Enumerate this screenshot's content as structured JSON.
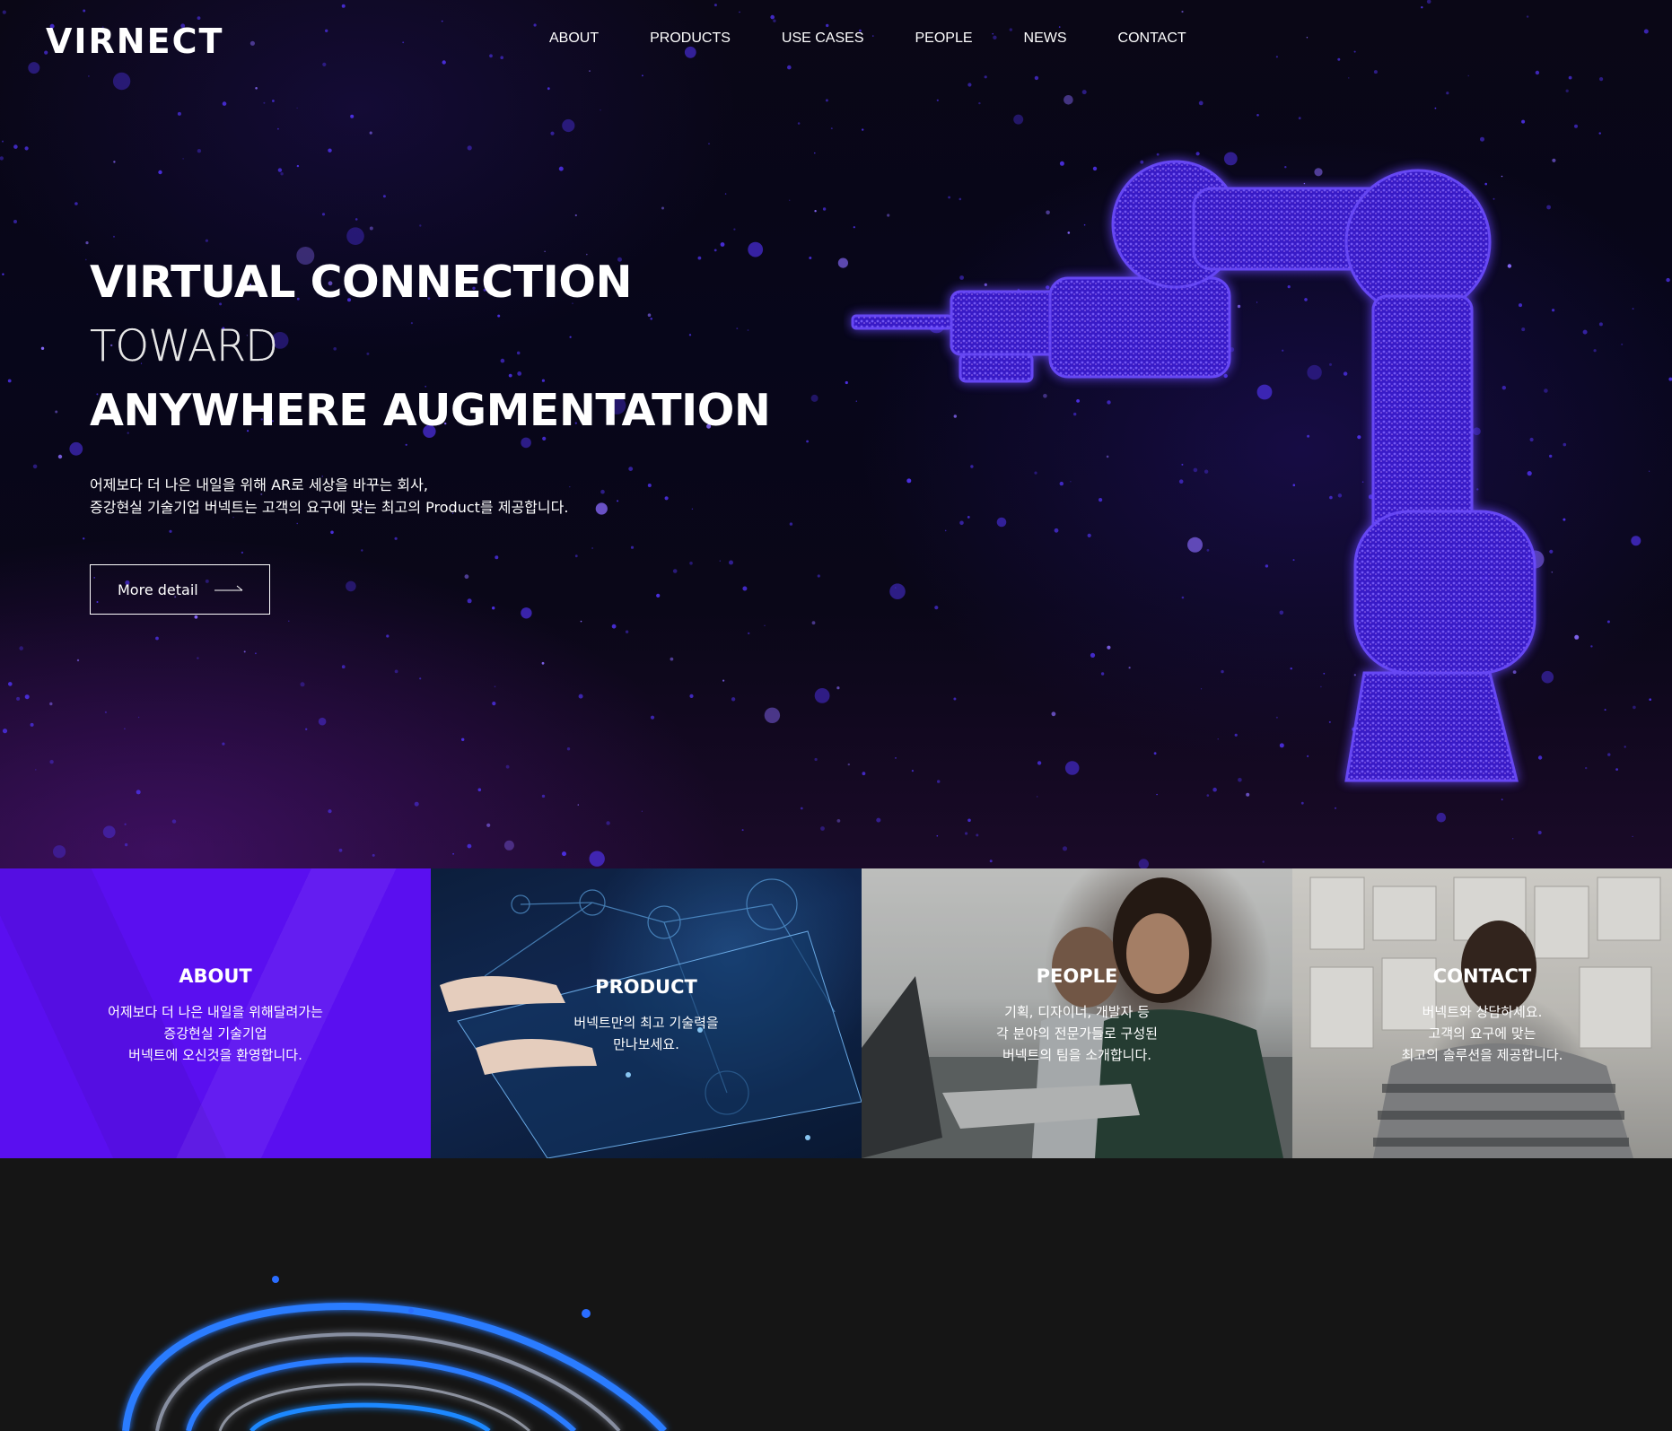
{
  "brand": {
    "logo_text": "VIRNECT"
  },
  "nav": {
    "items": [
      {
        "label": "ABOUT"
      },
      {
        "label": "PRODUCTS"
      },
      {
        "label": "USE CASES"
      },
      {
        "label": "PEOPLE"
      },
      {
        "label": "NEWS"
      },
      {
        "label": "CONTACT"
      }
    ]
  },
  "hero": {
    "title_line1": "VIRTUAL CONNECTION",
    "title_line2": "TOWARD",
    "title_line3": "ANYWHERE AUGMENTATION",
    "desc_line1": "어제보다 더 나은 내일을 위해 AR로 세상을 바꾸는 회사,",
    "desc_line2": "증강현실 기술기업 버넥트는 고객의 요구에 맞는 최고의 Product를 제공합니다.",
    "button_label": "More detail",
    "button_icon": "long-arrow-right-icon"
  },
  "cards": [
    {
      "title": "ABOUT",
      "lines": [
        "어제보다 더 나은 내일을 위해달려가는",
        "증강현실 기술기업",
        "버넥트에 오신것을 환영합니다."
      ],
      "color": "#5a0ff0"
    },
    {
      "title": "PRODUCT",
      "lines": [
        "버넥트만의 최고 기술력을",
        "만나보세요."
      ]
    },
    {
      "title": "PEOPLE",
      "lines": [
        "기획, 디자이너, 개발자 등",
        "각 분야의 전문가들로 구성된",
        "버넥트의 팀을 소개합니다."
      ]
    },
    {
      "title": "CONTACT",
      "lines": [
        "버넥트와 상담하세요.",
        "고객의 요구에 맞는",
        "최고의 솔루션을 제공합니다."
      ]
    }
  ],
  "colors": {
    "accent": "#5a0ff0",
    "hero_bg": "#07061a",
    "particle": "#5b3cff",
    "ring": "#2a7cff"
  }
}
